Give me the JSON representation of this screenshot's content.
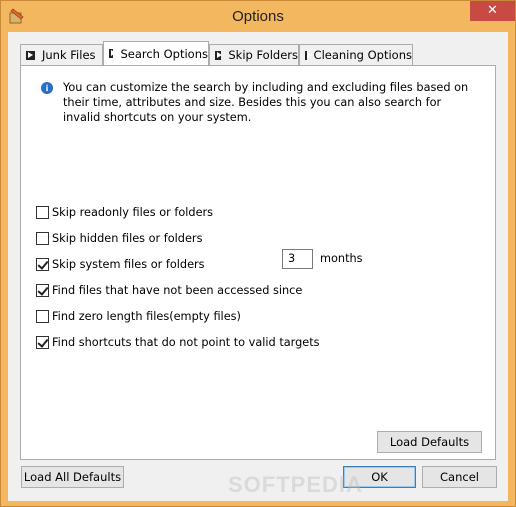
{
  "window": {
    "title": "Options",
    "close_label": "✕"
  },
  "tabs": [
    {
      "label": "Junk Files",
      "active": false
    },
    {
      "label": "Search Options",
      "active": true
    },
    {
      "label": "Skip Folders",
      "active": false
    },
    {
      "label": "Cleaning Options",
      "active": false
    }
  ],
  "info": {
    "icon": "info-icon",
    "text": "You can customize the search by including and excluding files based on their time, attributes and size. Besides this you can also search for invalid shortcuts on your system."
  },
  "options": [
    {
      "label": "Skip readonly files or folders",
      "checked": false
    },
    {
      "label": "Skip hidden files or folders",
      "checked": false
    },
    {
      "label": "Skip system files or folders",
      "checked": true
    },
    {
      "label": "Find files that have not been accessed since",
      "checked": true
    },
    {
      "label": "Find zero length files(empty files)",
      "checked": false
    },
    {
      "label": "Find shortcuts that do not point to valid targets",
      "checked": true
    }
  ],
  "months_value": "3",
  "months_label": "months",
  "buttons": {
    "load_defaults": "Load Defaults",
    "load_all_defaults": "Load All Defaults",
    "ok": "OK",
    "cancel": "Cancel"
  },
  "watermark": "SOFTPEDIA"
}
